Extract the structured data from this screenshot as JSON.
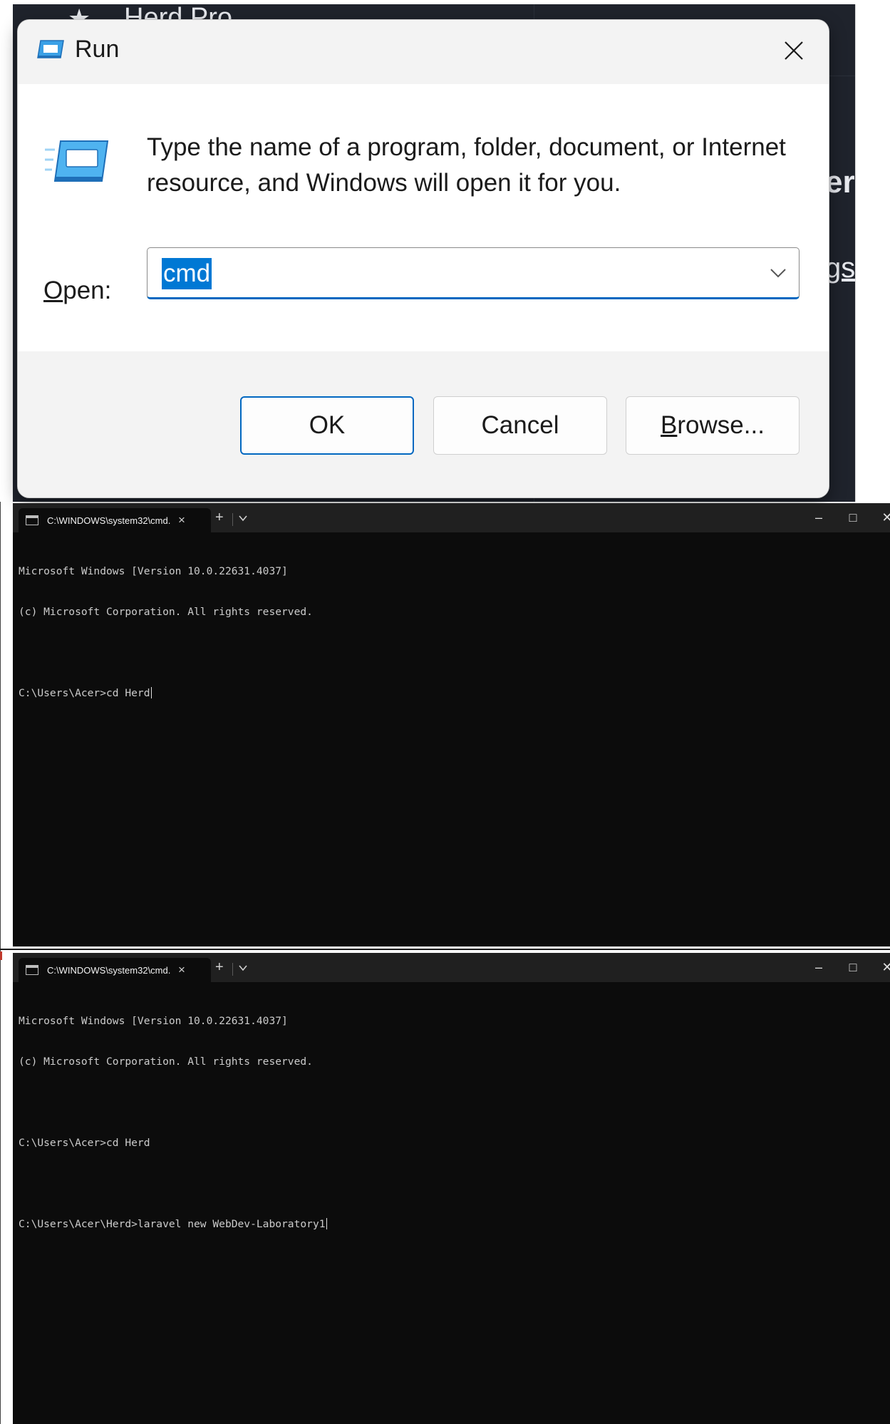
{
  "background_app": {
    "title": "Herd Pro",
    "heading_fragment": "er",
    "link_fragment": "gs",
    "star_icon": "star-icon"
  },
  "run_dialog": {
    "title": "Run",
    "description": "Type the name of a program, folder, document, or Internet resource, and Windows will open it for you.",
    "open_label_mnemonic": "O",
    "open_label_rest": "pen:",
    "open_value": "cmd",
    "ok_label": "OK",
    "cancel_label": "Cancel",
    "browse_mnemonic": "B",
    "browse_rest": "rowse...",
    "accent_color": "#0067c0",
    "selection_color": "#0078d4",
    "icons": [
      "run-icon",
      "close-icon",
      "chevron-down-icon"
    ]
  },
  "terminals": [
    {
      "tab_title": "C:\\WINDOWS\\system32\\cmd.",
      "lines": [
        "Microsoft Windows [Version 10.0.22631.4037]",
        "(c) Microsoft Corporation. All rights reserved.",
        "",
        "C:\\Users\\Acer>cd Herd"
      ]
    },
    {
      "tab_title": "C:\\WINDOWS\\system32\\cmd.",
      "lines": [
        "Microsoft Windows [Version 10.0.22631.4037]",
        "(c) Microsoft Corporation. All rights reserved.",
        "",
        "C:\\Users\\Acer>cd Herd",
        "",
        "C:\\Users\\Acer\\Herd>laravel new WebDev-Laboratory1"
      ]
    }
  ],
  "terminal_controls": {
    "new_tab": "+",
    "tab_close": "×",
    "minimize": "–",
    "maximize": "□",
    "close": "✕"
  }
}
